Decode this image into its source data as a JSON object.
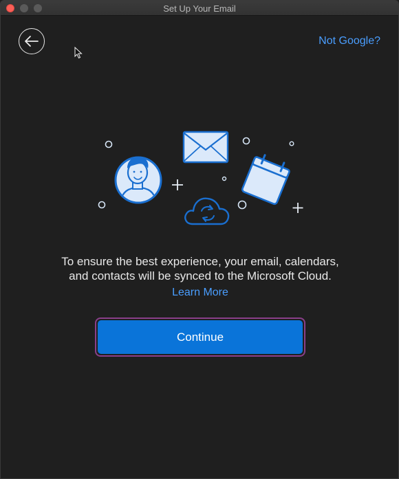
{
  "window": {
    "title": "Set Up Your Email"
  },
  "header": {
    "not_google_label": "Not Google?"
  },
  "main": {
    "message_line1": "To ensure the best experience, your email, calendars,",
    "message_line2": "and contacts will be synced to the Microsoft Cloud.",
    "learn_more_label": "Learn More",
    "continue_label": "Continue"
  },
  "icons": {
    "back": "back-arrow-icon",
    "person": "person-avatar-icon",
    "mail": "envelope-icon",
    "calendar": "calendar-icon",
    "cloud": "cloud-sync-icon"
  },
  "colors": {
    "background": "#1f1f1f",
    "accent": "#0a74d9",
    "link": "#4a9eff",
    "focus_ring": "#8a3f8a"
  }
}
